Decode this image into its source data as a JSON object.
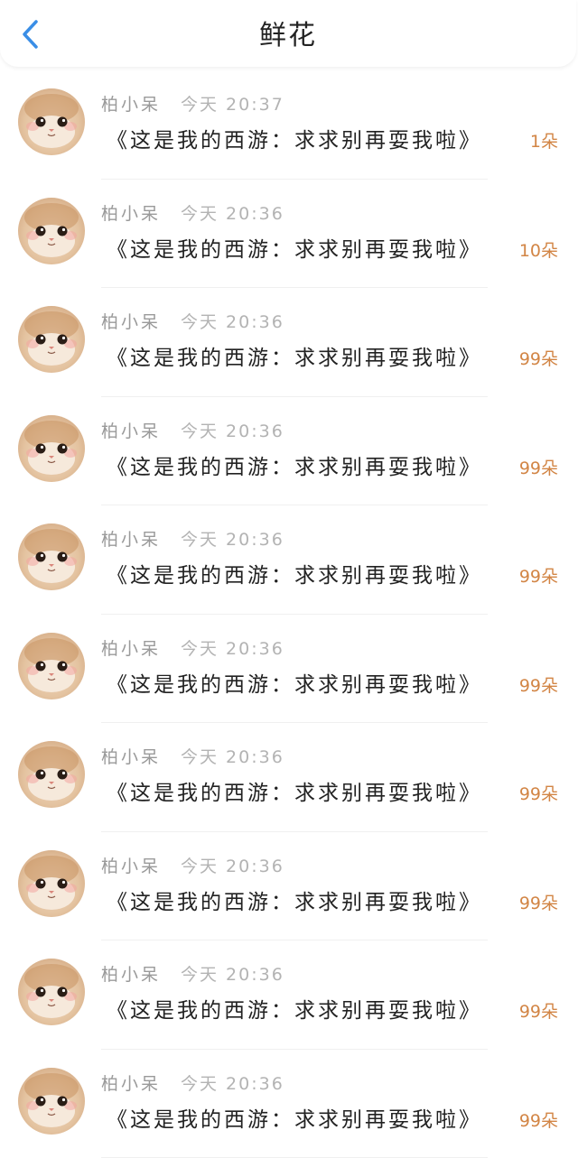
{
  "header": {
    "title": "鲜花",
    "back_icon": "chevron-left-icon",
    "accent_color": "#3a8ee6"
  },
  "items": [
    {
      "sender": "柏小呆",
      "time": "今天 20:37",
      "message": "《这是我的西游：求求别再耍我啦》",
      "count": "1朵"
    },
    {
      "sender": "柏小呆",
      "time": "今天 20:36",
      "message": "《这是我的西游：求求别再耍我啦》",
      "count": "10朵"
    },
    {
      "sender": "柏小呆",
      "time": "今天 20:36",
      "message": "《这是我的西游：求求别再耍我啦》",
      "count": "99朵"
    },
    {
      "sender": "柏小呆",
      "time": "今天 20:36",
      "message": "《这是我的西游：求求别再耍我啦》",
      "count": "99朵"
    },
    {
      "sender": "柏小呆",
      "time": "今天 20:36",
      "message": "《这是我的西游：求求别再耍我啦》",
      "count": "99朵"
    },
    {
      "sender": "柏小呆",
      "time": "今天 20:36",
      "message": "《这是我的西游：求求别再耍我啦》",
      "count": "99朵"
    },
    {
      "sender": "柏小呆",
      "time": "今天 20:36",
      "message": "《这是我的西游：求求别再耍我啦》",
      "count": "99朵"
    },
    {
      "sender": "柏小呆",
      "time": "今天 20:36",
      "message": "《这是我的西游：求求别再耍我啦》",
      "count": "99朵"
    },
    {
      "sender": "柏小呆",
      "time": "今天 20:36",
      "message": "《这是我的西游：求求别再耍我啦》",
      "count": "99朵"
    },
    {
      "sender": "柏小呆",
      "time": "今天 20:36",
      "message": "《这是我的西游：求求别再耍我啦》",
      "count": "99朵"
    }
  ]
}
